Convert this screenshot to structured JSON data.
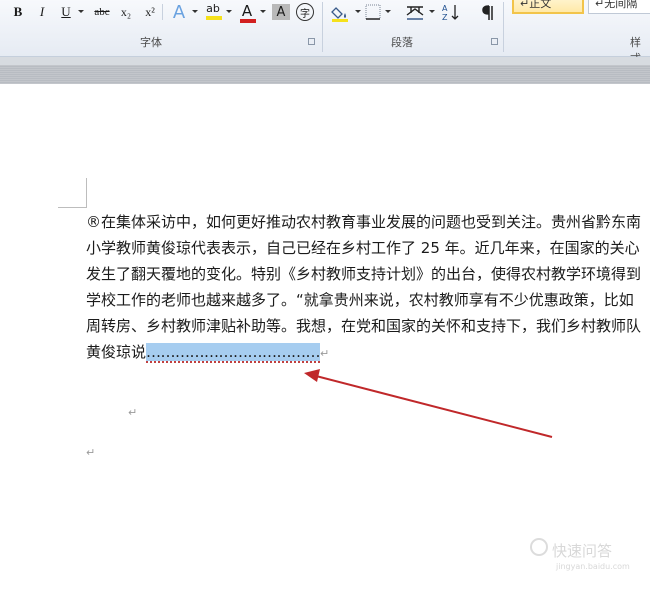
{
  "ribbon": {
    "font_group": {
      "label": "字体",
      "bold": "B",
      "italic": "I",
      "underline": "U",
      "strikethrough": "abc",
      "subscript": "x₂",
      "superscript": "x²",
      "effects_glyph": "A",
      "highlight_glyph": "ab",
      "font_color_glyph": "A",
      "char_shading_glyph": "A",
      "enclose_glyph": "字",
      "highlight_color": "#f5e11c",
      "font_color": "#d22020"
    },
    "paragraph_group": {
      "label": "段落"
    },
    "styles_group": {
      "label": "样式",
      "style_normal": "↵正文",
      "style_no_spacing": "↵无间隔"
    }
  },
  "document": {
    "lines": [
      "®在集体采访中，如何更好推动农村教育事业发展的问题也受到关注。贵州省黔东南",
      "小学教师黄俊琼代表表示，自己已经在乡村工作了 25 年。近几年来，在国家的关心",
      "发生了翻天覆地的变化。特别《乡村教师支持计划》的出台，使得农村教学环境得到",
      "学校工作的老师也越来越多了。“就拿贵州来说，农村教师享有不少优惠政策，比如",
      "周转房、乡村教师津贴补助等。我想，在党和国家的关怀和支持下，我们乡村教师队"
    ],
    "last_line_text": "黄俊琼说",
    "selected_text": "………………………………",
    "paragraph_mark": "↵"
  },
  "watermark": {
    "text": "快速问答",
    "url": "jingyan.baidu.com"
  },
  "annotation": {
    "arrow_color": "#c0282a"
  }
}
